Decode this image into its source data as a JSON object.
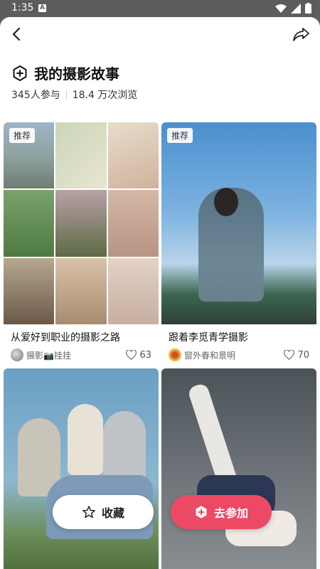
{
  "status": {
    "time": "1:35"
  },
  "page": {
    "title": "我的摄影故事",
    "participants": "345人参与",
    "views": "18.4 万次浏览"
  },
  "cards": [
    {
      "badge": "推荐",
      "caption": "从爱好到职业的摄影之路",
      "author": "摄影📷挂挂",
      "likes": "63",
      "image": "photo-collage"
    },
    {
      "badge": "推荐",
      "caption": "跟着李觅青学摄影",
      "author": "窗外春和景明",
      "likes": "70",
      "image": "woman-sitting-sky"
    },
    {
      "caption": "",
      "author": "",
      "likes": "",
      "image": "group-on-grass"
    },
    {
      "caption": "",
      "author": "",
      "likes": "",
      "image": "woman-lying-dark"
    }
  ],
  "actions": {
    "save_label": "收藏",
    "join_label": "去参加"
  },
  "colors": {
    "accent": "#ec4965",
    "status_bar": "#5c5c5c"
  }
}
